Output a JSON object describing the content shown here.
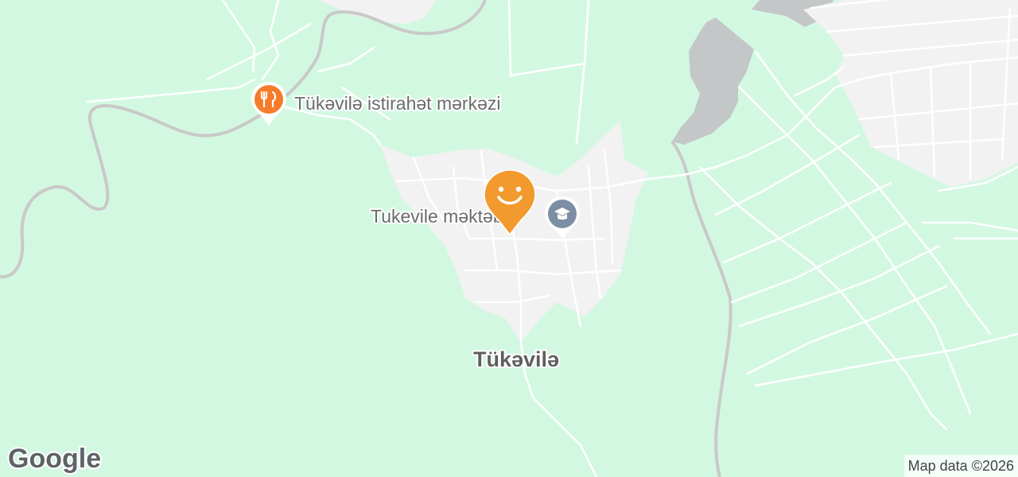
{
  "map": {
    "colors": {
      "land": "#d3f8e2",
      "built_up": "#f1f2f1",
      "water_gray": "#c4c7c7",
      "road": "#ffffff",
      "highway": "#c9c9c9",
      "poi_orange": "#f57c2b",
      "poi_school": "#7b8ea3",
      "marker": "#f29a2e"
    },
    "pois": [
      {
        "label": "Tükəvilə istirahət mərkəzi",
        "icon": "restaurant-icon",
        "color": "#f57c2b"
      },
      {
        "label": "Tukevile məktəbi",
        "icon": "school-icon",
        "color": "#7b8ea3"
      }
    ],
    "place": {
      "label": "Tükəvilə"
    },
    "marker": {
      "icon": "smiley-marker-icon",
      "color": "#f29a2e"
    }
  },
  "logo": {
    "text": "Google"
  },
  "attribution": {
    "text": "Map data ©2026"
  }
}
